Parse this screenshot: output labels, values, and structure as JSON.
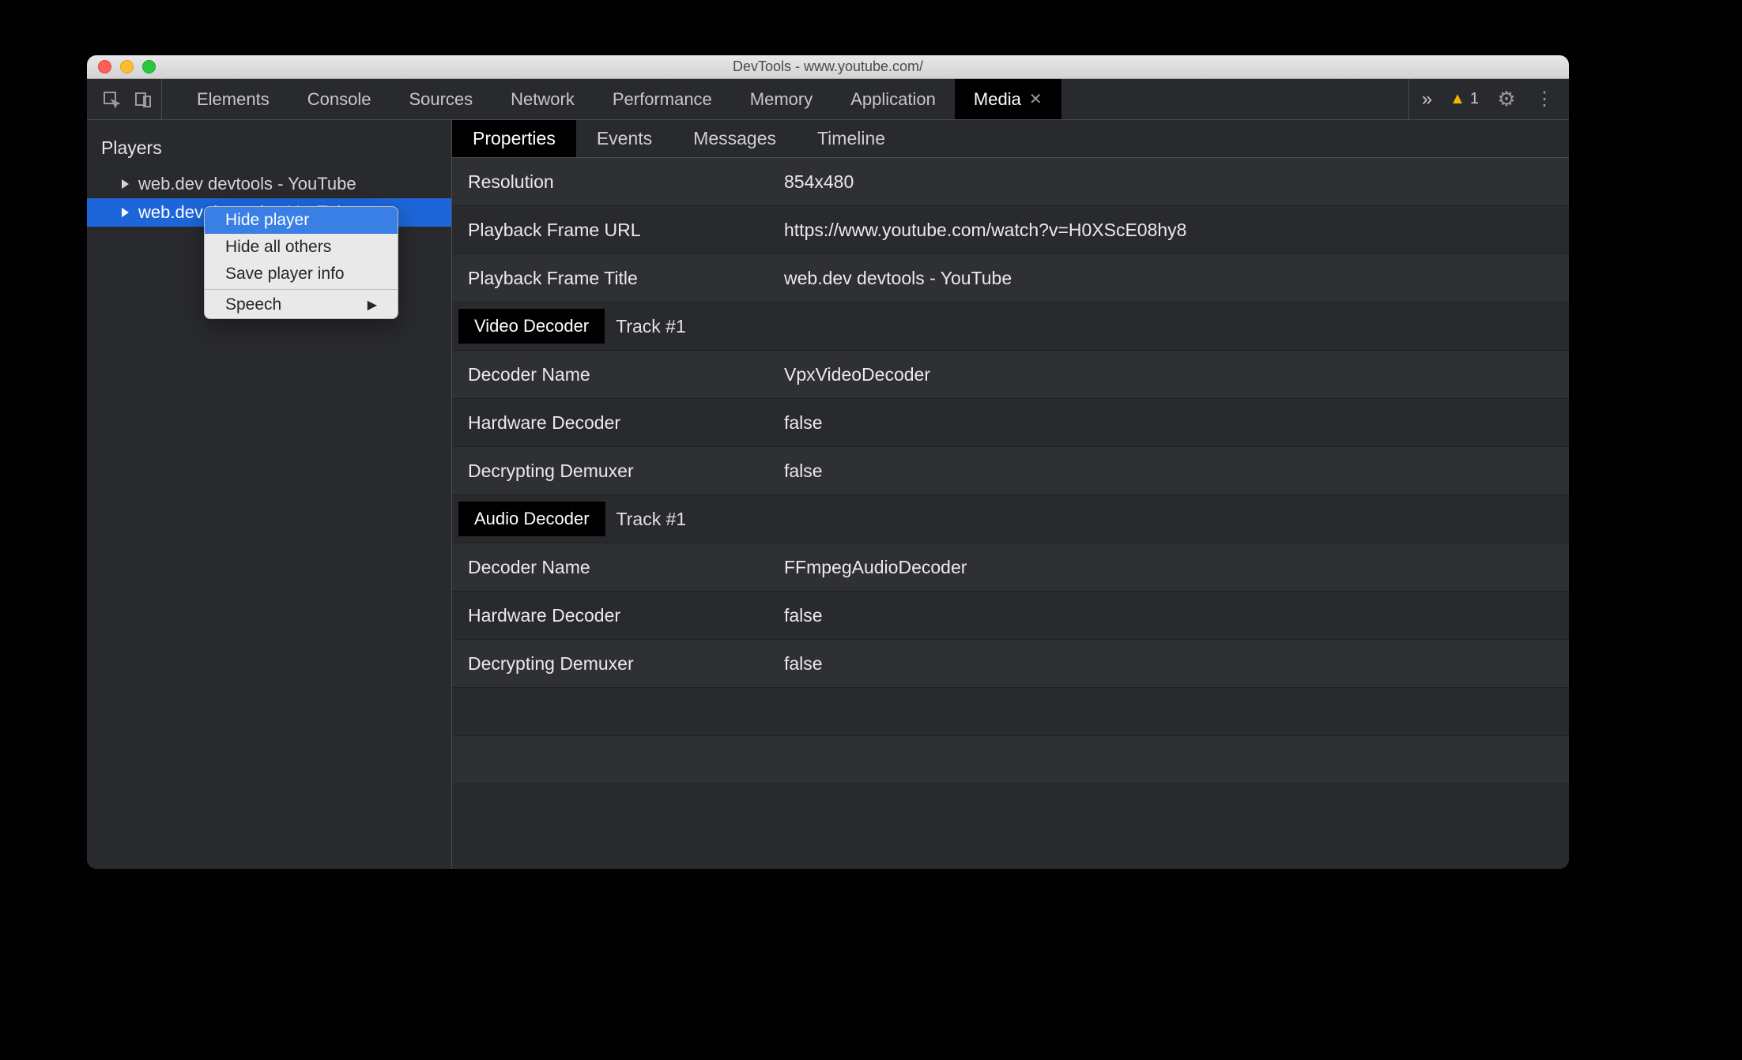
{
  "window_title": "DevTools - www.youtube.com/",
  "panels": [
    "Elements",
    "Console",
    "Sources",
    "Network",
    "Performance",
    "Memory",
    "Application",
    "Media"
  ],
  "active_panel": "Media",
  "warning_count": "1",
  "sidebar_heading": "Players",
  "players": [
    {
      "label": "web.dev devtools - YouTube",
      "selected": false
    },
    {
      "label": "web.dev devtools - YouTube",
      "selected": true
    }
  ],
  "context_menu": {
    "items": [
      "Hide player",
      "Hide all others",
      "Save player info"
    ],
    "highlighted": "Hide player",
    "submenu_item": "Speech"
  },
  "subtabs": [
    "Properties",
    "Events",
    "Messages",
    "Timeline"
  ],
  "active_subtab": "Properties",
  "properties": [
    {
      "label": "Resolution",
      "value": "854x480"
    },
    {
      "label": "Playback Frame URL",
      "value": "https://www.youtube.com/watch?v=H0XScE08hy8"
    },
    {
      "label": "Playback Frame Title",
      "value": "web.dev devtools - YouTube"
    }
  ],
  "video_decoder": {
    "heading": "Video Decoder",
    "track": "Track #1",
    "rows": [
      {
        "label": "Decoder Name",
        "value": "VpxVideoDecoder"
      },
      {
        "label": "Hardware Decoder",
        "value": "false"
      },
      {
        "label": "Decrypting Demuxer",
        "value": "false"
      }
    ]
  },
  "audio_decoder": {
    "heading": "Audio Decoder",
    "track": "Track #1",
    "rows": [
      {
        "label": "Decoder Name",
        "value": "FFmpegAudioDecoder"
      },
      {
        "label": "Hardware Decoder",
        "value": "false"
      },
      {
        "label": "Decrypting Demuxer",
        "value": "false"
      }
    ]
  }
}
